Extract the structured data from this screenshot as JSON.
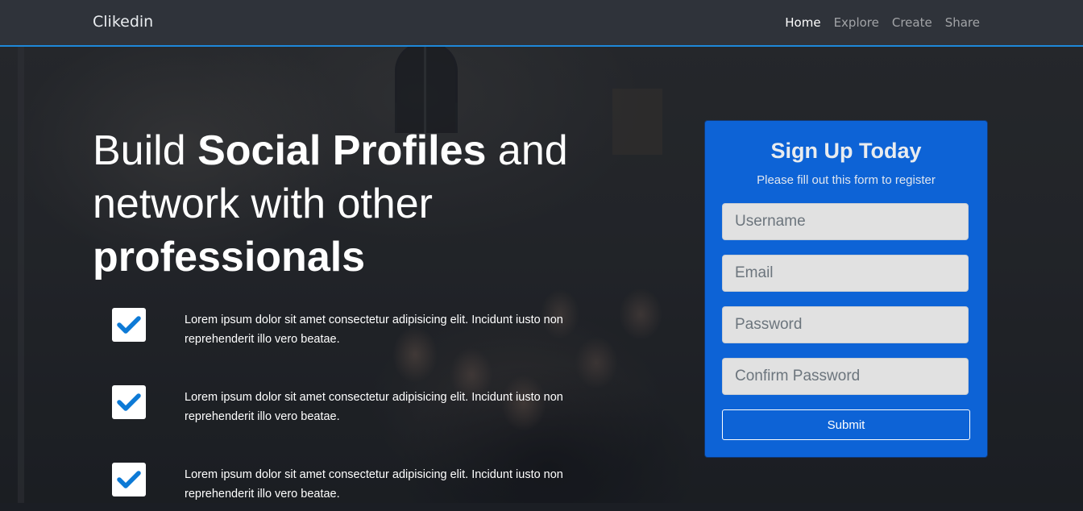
{
  "navbar": {
    "brand": "Clikedin",
    "links": [
      {
        "label": "Home",
        "active": true
      },
      {
        "label": "Explore",
        "active": false
      },
      {
        "label": "Create",
        "active": false
      },
      {
        "label": "Share",
        "active": false
      }
    ]
  },
  "hero": {
    "line1_light": "Build ",
    "line1_bold": "Social Profiles",
    "line1_end": " and",
    "line2": "network with other",
    "line3_bold": "professionals"
  },
  "features": [
    {
      "icon": "check-icon",
      "text": "Lorem ipsum dolor sit amet consectetur adipisicing elit. Incidunt iusto non reprehenderit illo vero beatae."
    },
    {
      "icon": "check-icon",
      "text": "Lorem ipsum dolor sit amet consectetur adipisicing elit. Incidunt iusto non reprehenderit illo vero beatae."
    },
    {
      "icon": "check-icon",
      "text": "Lorem ipsum dolor sit amet consectetur adipisicing elit. Incidunt iusto non reprehenderit illo vero beatae."
    }
  ],
  "signup": {
    "title": "Sign Up Today",
    "subtitle": "Please fill out this form to register",
    "fields": {
      "username": {
        "placeholder": "Username",
        "value": ""
      },
      "email": {
        "placeholder": "Email",
        "value": ""
      },
      "password": {
        "placeholder": "Password",
        "value": ""
      },
      "confirm_password": {
        "placeholder": "Confirm Password",
        "value": ""
      }
    },
    "submit_label": "Submit"
  },
  "colors": {
    "accent": "#0d63d6",
    "navbar_border": "#1e88d9",
    "check": "#0d7ad6"
  }
}
